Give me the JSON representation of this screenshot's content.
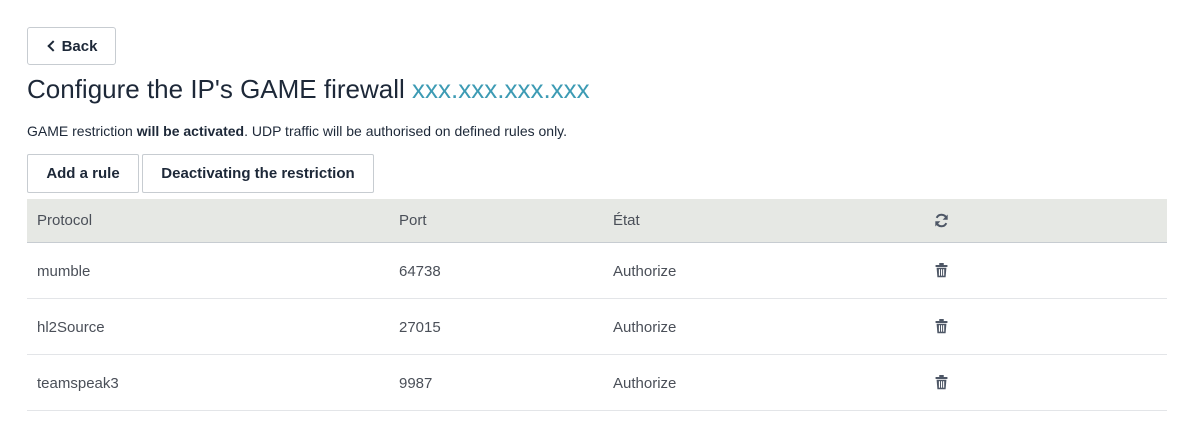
{
  "back_button": {
    "label": "Back",
    "icon": "chevron-left-icon"
  },
  "header": {
    "title_prefix": "Configure the IP's GAME firewall",
    "ip": "xxx.xxx.xxx.xxx"
  },
  "description": {
    "part1": "GAME restriction",
    "bold": "will be activated",
    "part2": ". UDP traffic will be authorised on defined rules only."
  },
  "actions": {
    "add_rule": "Add a rule",
    "deactivate": "Deactivating the restriction"
  },
  "table": {
    "headers": {
      "protocol": "Protocol",
      "port": "Port",
      "state": "État",
      "refresh_icon": "refresh-icon"
    },
    "rows": [
      {
        "protocol": "mumble",
        "port": "64738",
        "state": "Authorize",
        "action_icon": "trash-icon"
      },
      {
        "protocol": "hl2Source",
        "port": "27015",
        "state": "Authorize",
        "action_icon": "trash-icon"
      },
      {
        "protocol": "teamspeak3",
        "port": "9987",
        "state": "Authorize",
        "action_icon": "trash-icon"
      }
    ]
  },
  "colors": {
    "accent_ip": "#3d9bb4",
    "header_bg": "#e6e8e4",
    "text_dark": "#1d2838",
    "text_muted": "#4a4f58"
  }
}
